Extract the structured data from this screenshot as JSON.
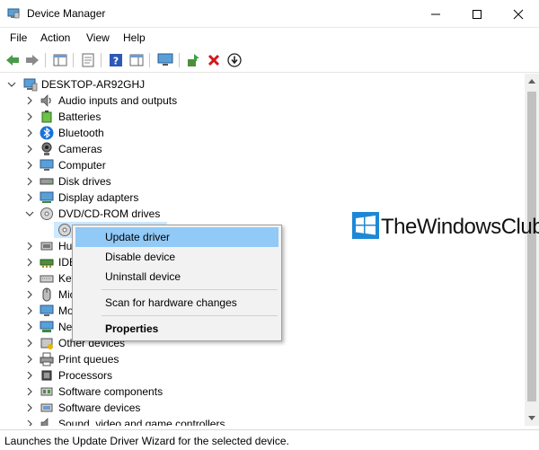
{
  "window": {
    "title": "Device Manager"
  },
  "menu": {
    "file": "File",
    "action": "Action",
    "view": "View",
    "help": "Help"
  },
  "tree": {
    "root": "DESKTOP-AR92GHJ",
    "items": [
      "Audio inputs and outputs",
      "Batteries",
      "Bluetooth",
      "Cameras",
      "Computer",
      "Disk drives",
      "Display adapters",
      "DVD/CD-ROM drives",
      "",
      "Hu",
      "IDE",
      "Key",
      "Mic",
      "Mo",
      "Ne",
      "Other devices",
      "Print queues",
      "Processors",
      "Software components",
      "Software devices",
      "Sound, video and game controllers"
    ]
  },
  "context_menu": {
    "update": "Update driver",
    "disable": "Disable device",
    "uninstall": "Uninstall device",
    "scan": "Scan for hardware changes",
    "properties": "Properties"
  },
  "watermark": {
    "text": "TheWindowsClub"
  },
  "status": {
    "text": "Launches the Update Driver Wizard for the selected device."
  }
}
